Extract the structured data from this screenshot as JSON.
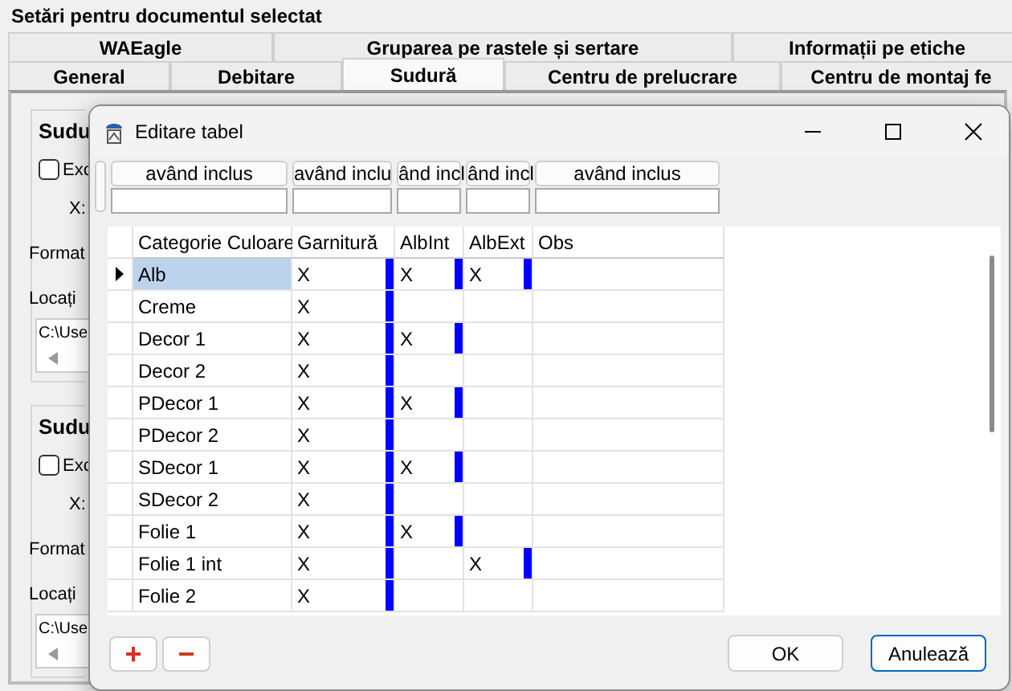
{
  "window": {
    "title": "Setări pentru documentul selectat"
  },
  "tabs_row_1": [
    {
      "label": "WAEagle",
      "selected": false
    },
    {
      "label": "Gruparea pe rastele și sertare",
      "selected": false
    },
    {
      "label": "Informații pe etiche",
      "selected": false
    }
  ],
  "tabs_row_2": [
    {
      "label": "General",
      "selected": false
    },
    {
      "label": "Debitare",
      "selected": false
    },
    {
      "label": "Sudură",
      "selected": true
    },
    {
      "label": "Centru de prelucrare",
      "selected": false
    },
    {
      "label": "Centru de montaj fe",
      "selected": false
    }
  ],
  "background_groups": [
    {
      "title": "Sudu",
      "checkbox": {
        "label": "Exc",
        "checked": false
      },
      "x_label": "X:",
      "format_label": "Format",
      "location_label": "Locați",
      "location_value": "C:\\Use"
    },
    {
      "title": "Sudu",
      "checkbox": {
        "label": "Exc",
        "checked": false
      },
      "x_label": "X:",
      "format_label": "Format",
      "location_label": "Locați",
      "location_value": "C:\\Use"
    }
  ],
  "dialog": {
    "title": "Editare tabel",
    "filters": [
      {
        "label": "având inclus"
      },
      {
        "label": "având inclu"
      },
      {
        "label": "ând incl"
      },
      {
        "label": "ând incl"
      },
      {
        "label": "având inclus"
      }
    ],
    "columns": [
      "Categorie Culoare",
      "Garnitură",
      "AlbInt",
      "AlbExt",
      "Obs"
    ],
    "rows": [
      {
        "categorie": "Alb",
        "garnitura": "X",
        "alb_int": "X",
        "alb_ext": "X",
        "selected": true
      },
      {
        "categorie": "Creme",
        "garnitura": "X",
        "selected": false
      },
      {
        "categorie": "Decor 1",
        "garnitura": "X",
        "alb_int": "X",
        "selected": false
      },
      {
        "categorie": "Decor 2",
        "garnitura": "X",
        "selected": false
      },
      {
        "categorie": "PDecor 1",
        "garnitura": "X",
        "alb_int": "X",
        "selected": false
      },
      {
        "categorie": "PDecor 2",
        "garnitura": "X",
        "selected": false
      },
      {
        "categorie": "SDecor 1",
        "garnitura": "X",
        "alb_int": "X",
        "selected": false
      },
      {
        "categorie": "SDecor 2",
        "garnitura": "X",
        "selected": false
      },
      {
        "categorie": "Folie 1",
        "garnitura": "X",
        "alb_int": "X",
        "selected": false
      },
      {
        "categorie": "Folie 1 int",
        "garnitura": "X",
        "alb_ext": "X",
        "selected": false
      },
      {
        "categorie": "Folie 2",
        "garnitura": "X",
        "selected": false
      }
    ],
    "buttons": {
      "add": "+",
      "remove": "−",
      "ok": "OK",
      "cancel": "Anulează"
    }
  }
}
